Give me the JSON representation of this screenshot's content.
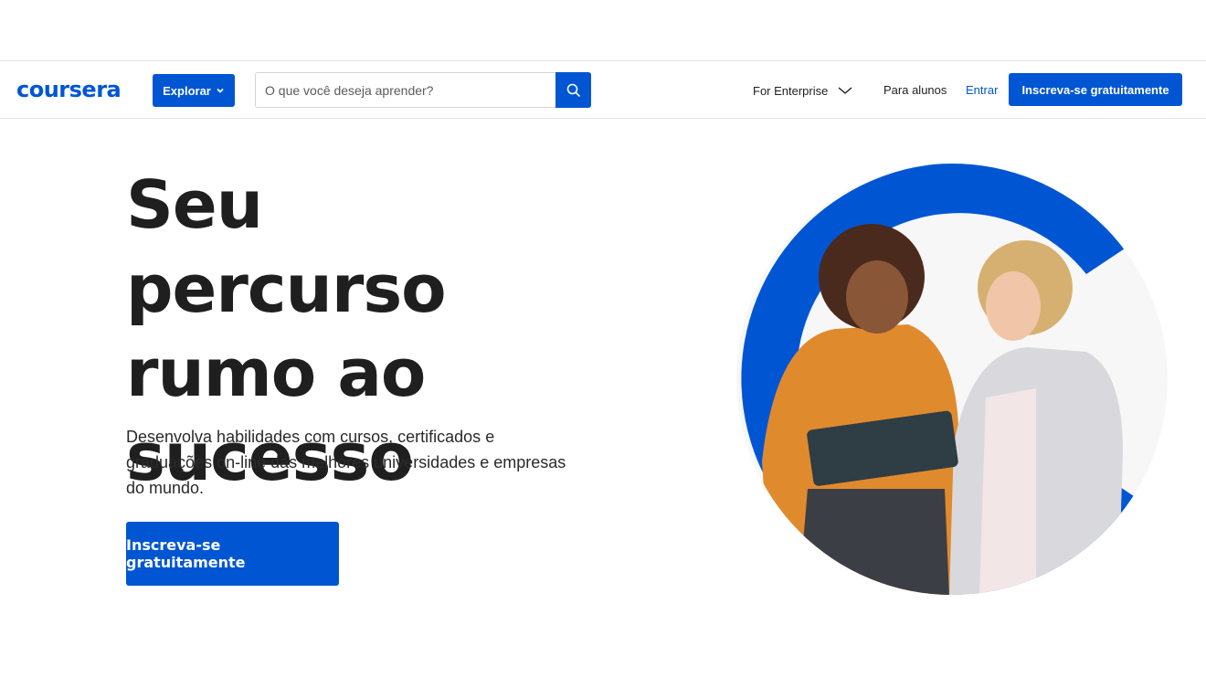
{
  "header": {
    "logo_text": "coursera",
    "explore_label": "Explorar",
    "search": {
      "placeholder": "O que você deseja aprender?",
      "value": ""
    },
    "nav": {
      "enterprise_label": "For Enterprise",
      "students_label": "Para alunos",
      "login_label": "Entrar",
      "signup_label": "Inscreva-se gratuitamente"
    }
  },
  "hero": {
    "title_lines": [
      "Seu percurso",
      "rumo ao",
      "sucesso"
    ],
    "subtitle": "Desenvolva habilidades com cursos, certificados e graduações on-line das melhores universidades e empresas do mundo.",
    "cta_label": "Inscreva-se gratuitamente"
  },
  "colors": {
    "brand_blue": "#0056d2",
    "text_dark": "#1f1f1f"
  },
  "icons": {
    "explore_chevron": "chevron-down-icon",
    "search": "search-icon",
    "enterprise_chevron": "chevron-down-icon"
  }
}
